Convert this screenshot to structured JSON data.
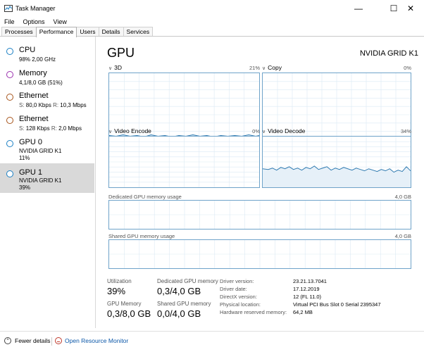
{
  "window": {
    "title": "Task Manager"
  },
  "menu": [
    "File",
    "Options",
    "View"
  ],
  "tabs": [
    "Processes",
    "Performance",
    "Users",
    "Details",
    "Services"
  ],
  "sidebar": {
    "items": [
      {
        "name": "CPU",
        "line1": "98%  2,00 GHz",
        "color": "#1a7fc4"
      },
      {
        "name": "Memory",
        "line1": "4,1/8,0 GB (51%)",
        "color": "#9b2fae"
      },
      {
        "name": "Ethernet",
        "line1_s_label": "S:",
        "line1_s": "80,0 Kbps",
        "line1_r_label": "R:",
        "line1_r": "10,3 Mbps",
        "color": "#a7541b"
      },
      {
        "name": "Ethernet",
        "line1_s_label": "S:",
        "line1_s": "128 Kbps",
        "line1_r_label": "R:",
        "line1_r": "2,0 Mbps",
        "color": "#a7541b"
      },
      {
        "name": "GPU 0",
        "line1": "NVIDIA GRID K1",
        "line2": "11%",
        "color": "#1a7fc4"
      },
      {
        "name": "GPU 1",
        "line1": "NVIDIA GRID K1",
        "line2": "39%",
        "color": "#1a7fc4"
      }
    ]
  },
  "main": {
    "title": "GPU",
    "device": "NVIDIA GRID K1",
    "graphs": [
      {
        "label": "3D",
        "pct": "21%"
      },
      {
        "label": "Copy",
        "pct": "0%"
      },
      {
        "label": "Video Encode",
        "pct": "0%"
      },
      {
        "label": "Video Decode",
        "pct": "34%"
      }
    ],
    "dedicated": {
      "label": "Dedicated GPU memory usage",
      "max": "4,0 GB"
    },
    "shared": {
      "label": "Shared GPU memory usage",
      "max": "4,0 GB"
    },
    "stats": {
      "utilization_label": "Utilization",
      "utilization": "39%",
      "dedicated_label": "Dedicated GPU memory",
      "dedicated": "0,3/4,0 GB",
      "gpu_memory_label": "GPU Memory",
      "gpu_memory": "0,3/8,0 GB",
      "shared_label": "Shared GPU memory",
      "shared": "0,0/4,0 GB"
    },
    "info": [
      {
        "key": "Driver version:",
        "value": "23.21.13.7041"
      },
      {
        "key": "Driver date:",
        "value": "17.12.2019"
      },
      {
        "key": "DirectX version:",
        "value": "12 (FL 11.0)"
      },
      {
        "key": "Physical location:",
        "value": "Virtual PCI Bus Slot 0 Serial 2395347"
      },
      {
        "key": "Hardware reserved memory:",
        "value": "64,2 MB"
      }
    ]
  },
  "footer": {
    "fewer_details": "Fewer details",
    "open_monitor": "Open Resource Monitor"
  }
}
